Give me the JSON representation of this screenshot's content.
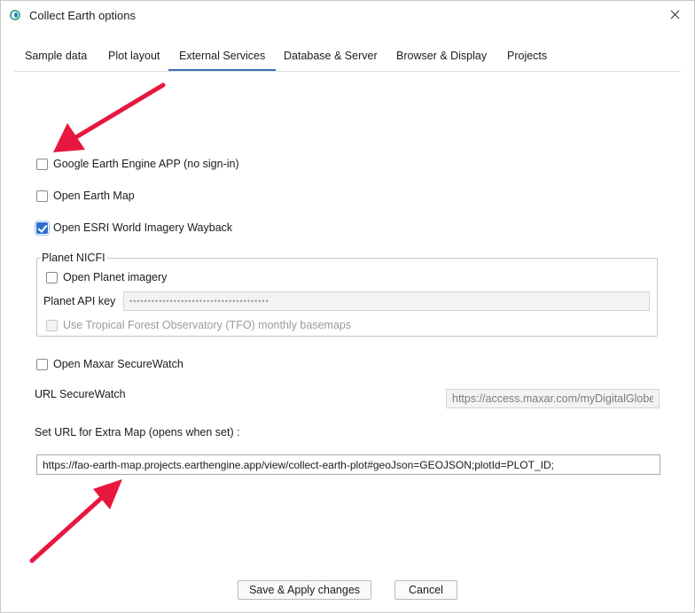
{
  "window": {
    "title": "Collect Earth options",
    "app_icon": "collect-earth-icon",
    "close_icon": "close-icon"
  },
  "tabs": [
    {
      "label": "Sample data",
      "active": false
    },
    {
      "label": "Plot layout",
      "active": false
    },
    {
      "label": "External Services",
      "active": true
    },
    {
      "label": "Database & Server",
      "active": false
    },
    {
      "label": "Browser & Display",
      "active": false
    },
    {
      "label": "Projects",
      "active": false
    }
  ],
  "options": {
    "gee_app": {
      "label": "Google Earth Engine APP (no sign-in)",
      "checked": false
    },
    "earth_map": {
      "label": "Open Earth Map",
      "checked": false
    },
    "esri_wayback": {
      "label": "Open ESRI World Imagery Wayback",
      "checked": true
    }
  },
  "planet": {
    "group_title": "Planet NICFI",
    "open_imagery": {
      "label": "Open Planet imagery",
      "checked": false
    },
    "api_key_label": "Planet API key",
    "api_key_value": "••••••••••••••••••••••••••••••••••••••",
    "tfo": {
      "label": "Use Tropical Forest Observatory (TFO) monthly basemaps",
      "checked": false,
      "enabled": false
    }
  },
  "maxar": {
    "open_securewatch": {
      "label": "Open Maxar SecureWatch",
      "checked": false
    },
    "url_label": "URL SecureWatch",
    "url_value": "https://access.maxar.com/myDigitalGlobe"
  },
  "extra_map": {
    "label": "Set URL for Extra Map (opens when set) :",
    "value": "https://fao-earth-map.projects.earthengine.app/view/collect-earth-plot#geoJson=GEOJSON;plotId=PLOT_ID;"
  },
  "buttons": {
    "save": "Save & Apply changes",
    "cancel": "Cancel"
  },
  "colors": {
    "accent": "#3c71b7",
    "checkbox_checked": "#2a6fc9",
    "annotation_arrow": "#e8173f"
  }
}
